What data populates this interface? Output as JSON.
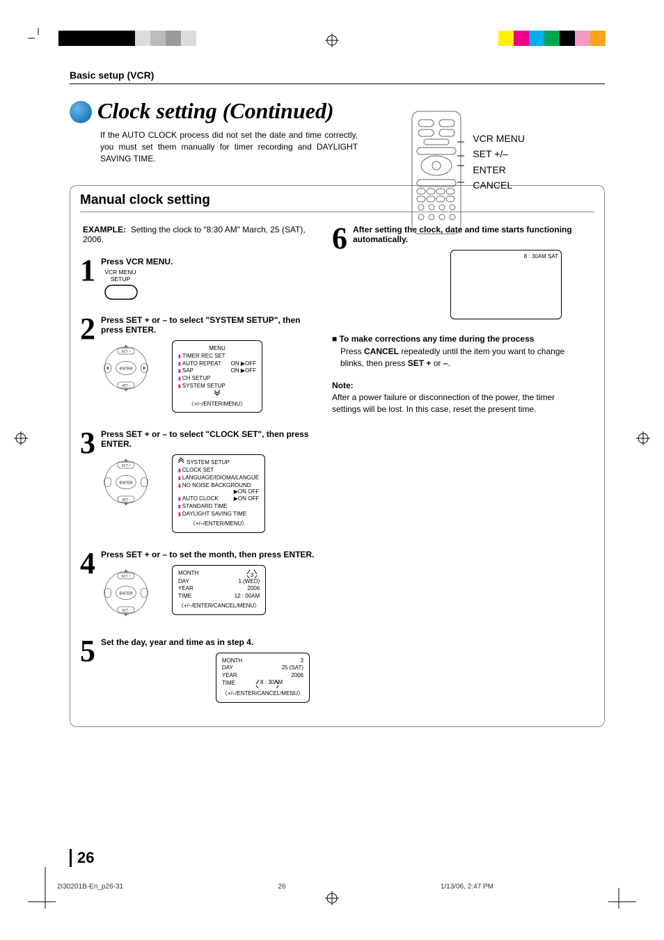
{
  "header": {
    "section": "Basic setup (VCR)"
  },
  "title": "Clock setting (Continued)",
  "intro": "If the AUTO CLOCK process did not set the date and time correctly, you must set them manually for timer recording and DAYLIGHT SAVING TIME.",
  "remote": {
    "labels": [
      "VCR MENU",
      "SET +/–",
      "ENTER",
      "CANCEL"
    ]
  },
  "section": {
    "title": "Manual clock setting"
  },
  "example": {
    "label": "EXAMPLE:",
    "text": "Setting the clock to \"8:30 AM\" March, 25 (SAT), 2006."
  },
  "step1": {
    "title": "Press VCR MENU.",
    "btn_top": "VCR MENU",
    "btn_bottom": "SETUP"
  },
  "step2": {
    "title": "Press SET + or – to select \"SYSTEM SETUP\", then press ENTER.",
    "pad": {
      "up": "SET +",
      "down": "SET -",
      "center": "ENTER"
    },
    "osd": {
      "head": "MENU",
      "l1": "TIMER REC SET",
      "l2": "AUTO REPEAT",
      "l2v": "ON ▶OFF",
      "l3": "SAP",
      "l3v": "ON ▶OFF",
      "l4": "CH SETUP",
      "l5": "SYSTEM SETUP",
      "foot": "〈+/–/ENTER/MENU〉"
    }
  },
  "step3": {
    "title": "Press SET + or – to select \"CLOCK SET\", then press ENTER.",
    "osd": {
      "head": "SYSTEM SETUP",
      "l1": "CLOCK SET",
      "l2": "LANGUAGE/IDIOMA/LANGUE",
      "l3": "NO NOISE BACKGROUND",
      "l3v": "▶ON   OFF",
      "l4": "AUTO CLOCK",
      "l4v": "▶ON   OFF",
      "l5": "STANDARD TIME",
      "l6": "DAYLIGHT SAVING TIME",
      "foot": "〈+/–/ENTER/MENU〉"
    }
  },
  "step4": {
    "title": "Press SET + or – to set the month, then press ENTER.",
    "osd": {
      "month_l": "MONTH",
      "month_v": "3",
      "day_l": "DAY",
      "day_v": "1 (WED)",
      "year_l": "YEAR",
      "year_v": "2006",
      "time_l": "TIME",
      "time_v": "12 : 00AM",
      "foot": "〈+/–/ENTER/CANCEL/MENU〉"
    }
  },
  "step5": {
    "title": "Set the day, year and time as in step 4.",
    "osd": {
      "month_v": "3",
      "day_v": "25 (SAT)",
      "year_v": "2006",
      "time_v": "8 : 30AM",
      "foot": "〈+/–/ENTER/CANCEL/MENU〉"
    }
  },
  "step6": {
    "title": "After setting the clock, date and time starts functioning automatically.",
    "tv_time": "8 : 30AM  SAT"
  },
  "corrections": {
    "head": "To make corrections any time during the process",
    "l1a": "Press ",
    "l1b": "CANCEL",
    "l1c": " repeatedly until the item you want to change blinks, then press ",
    "l1d": "SET +",
    "l1e": " or ",
    "l1f": "–",
    "l1g": "."
  },
  "note": {
    "label": "Note:",
    "text": "After a power failure or disconnection of the power, the timer settings will be lost. In this case, reset the present time."
  },
  "page_number": "26",
  "footer": {
    "file": "2I30201B-En_p26-31",
    "page": "26",
    "date": "1/13/06, 2:47 PM"
  }
}
